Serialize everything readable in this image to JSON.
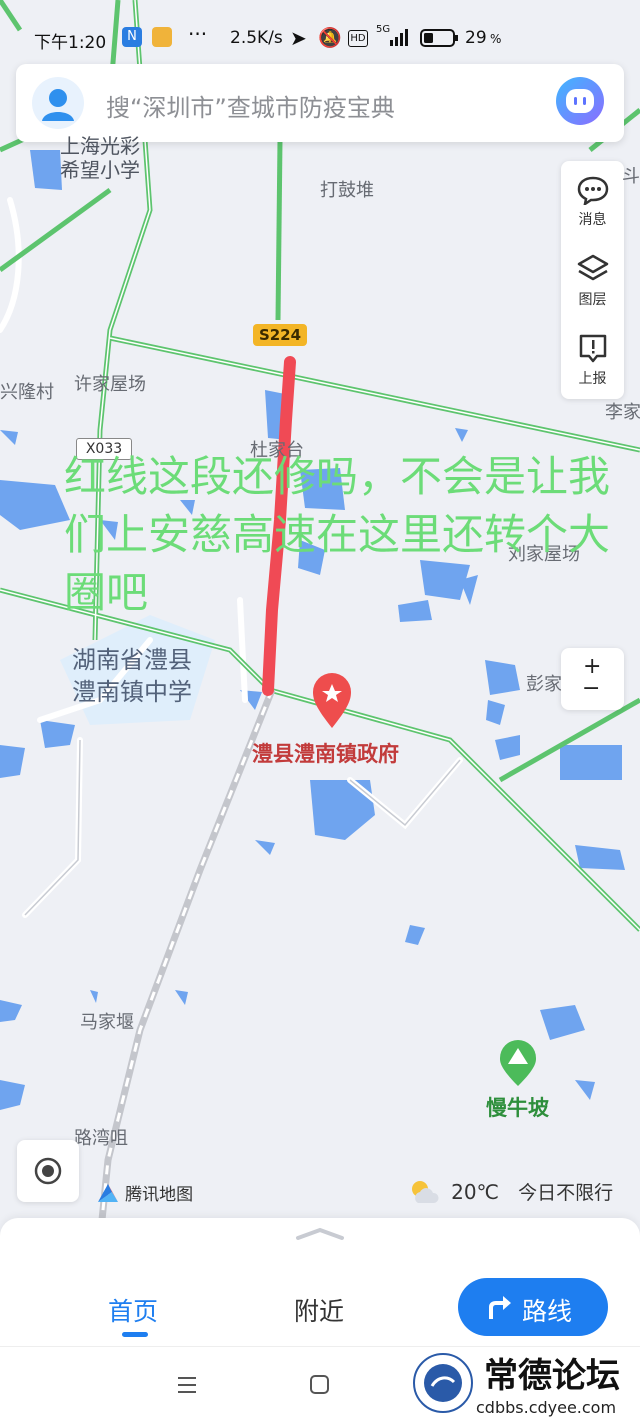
{
  "status_bar": {
    "time": "下午1:20",
    "speed": "2.5K/s",
    "network": "5G",
    "battery": "29"
  },
  "search": {
    "placeholder": "搜“深圳市”查城市防疫宝典"
  },
  "right_tools": {
    "messages": "消息",
    "layers": "图层",
    "report": "上报"
  },
  "zoom": {
    "plus": "+",
    "minus": "−"
  },
  "map": {
    "road_badge": "S224",
    "road_badge_2": "X033",
    "labels": {
      "school_top": "上海光彩\n希望小学",
      "dagudui": "打鼓堆",
      "xinglongcun": "兴隆村",
      "xujiawuchang": "许家屋场",
      "li": "李家",
      "du": "杜家台",
      "liujiawuchang": "刘家屋场",
      "peng": "彭家",
      "majiayan": "马家堰",
      "luwanzui": "路湾咀",
      "dou": "斗"
    },
    "school": "湖南省澧县\n澧南镇中学",
    "poi_government": "澧县澧南镇政府",
    "poi_mountain": "慢牛坡",
    "annotation": "红线这段还修吗，不会是让我们上安慈高速在这里还转个大圈吧",
    "attribution": "腾讯地图"
  },
  "weather": {
    "temp": "20℃",
    "restriction": "今日不限行"
  },
  "bottom_tabs": {
    "home": "首页",
    "nearby": "附近",
    "route": "路线"
  },
  "watermark": {
    "title": "常德论坛",
    "url": "cdbbs.cdyee.com"
  },
  "colors": {
    "accent": "#1e7ef0",
    "annotation": "#6cdc78",
    "red_line": "#f04a55",
    "green_road": "#5dc46e"
  }
}
